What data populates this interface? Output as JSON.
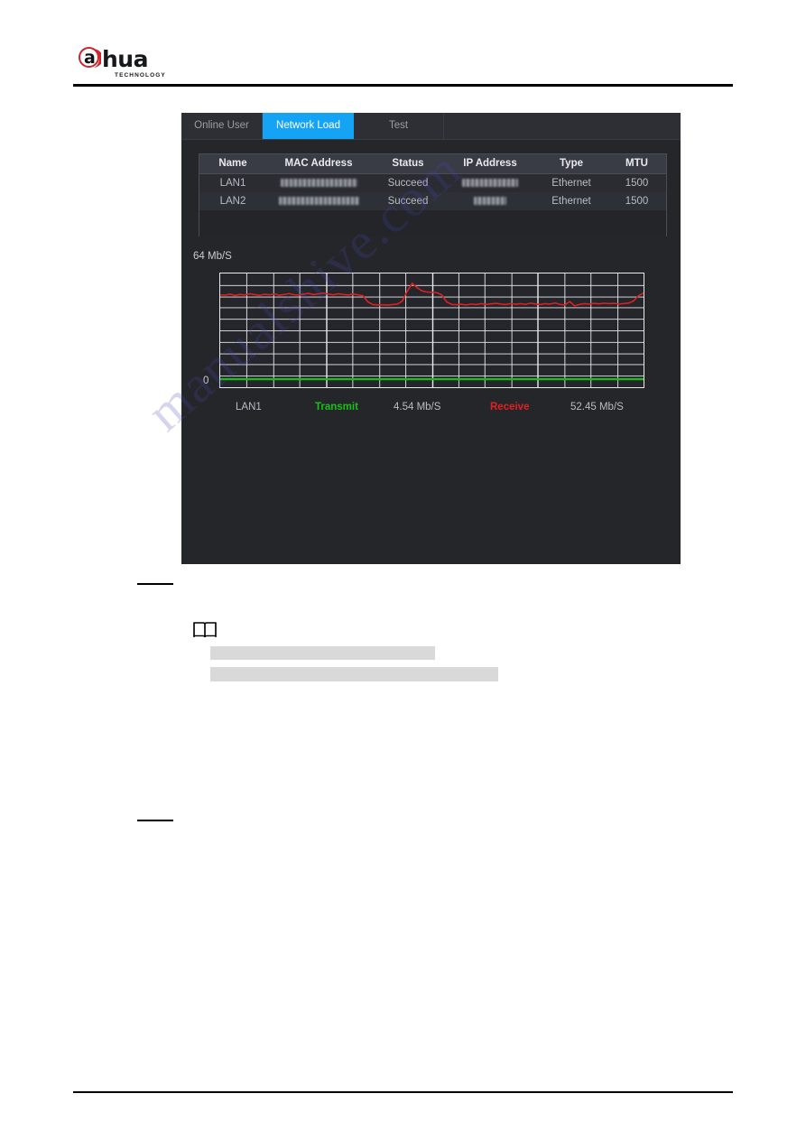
{
  "brand": {
    "name": "alhua",
    "letter": "a",
    "wordmark": "hua",
    "tagline": "TECHNOLOGY"
  },
  "device_ui": {
    "tabs": [
      {
        "label": "Online User",
        "active": false
      },
      {
        "label": "Network Load",
        "active": true
      },
      {
        "label": "Test",
        "active": false
      }
    ],
    "nic_table": {
      "headers": [
        "Name",
        "MAC Address",
        "Status",
        "IP Address",
        "Type",
        "MTU"
      ],
      "rows": [
        {
          "name": "LAN1",
          "mac": "",
          "status": "Succeed",
          "ip": "",
          "type": "Ethernet",
          "mtu": "1500"
        },
        {
          "name": "LAN2",
          "mac": "",
          "status": "Succeed",
          "ip": "",
          "type": "Ethernet",
          "mtu": "1500"
        }
      ]
    },
    "legend": {
      "interface": "LAN1",
      "transmit_label": "Transmit",
      "transmit_value": "4.54 Mb/S",
      "receive_label": "Receive",
      "receive_value": "52.45 Mb/S"
    },
    "colors": {
      "accent": "#15a4f5",
      "panel": "#252629",
      "transmit": "#18c018",
      "receive": "#e02020",
      "grid": "#e9eaec"
    }
  },
  "chart_data": {
    "type": "line",
    "title": "Network Load",
    "xlabel": "",
    "ylabel": "Mb/S",
    "ylim": [
      0,
      64
    ],
    "ytick_labels": [
      "64 Mb/S",
      "0"
    ],
    "grid": true,
    "legend_position": "bottom",
    "series": [
      {
        "name": "Receive",
        "color": "#e02020",
        "unit": "Mb/S",
        "current": 52.45,
        "values": [
          52.0,
          51.8,
          52.4,
          51.6,
          52.2,
          51.9,
          52.6,
          52.1,
          51.7,
          52.3,
          52.0,
          52.5,
          51.8,
          52.2,
          52.7,
          52.0,
          51.9,
          52.4,
          52.8,
          52.1,
          52.5,
          53.0,
          52.4,
          52.0,
          52.6,
          52.2,
          51.9,
          52.4,
          52.0,
          51.5,
          48.0,
          46.5,
          46.3,
          46.4,
          46.2,
          46.5,
          46.8,
          48.5,
          54.0,
          58.5,
          56.0,
          54.2,
          53.6,
          53.4,
          53.2,
          52.0,
          48.0,
          46.6,
          46.4,
          46.7,
          46.3,
          46.8,
          46.5,
          47.0,
          46.6,
          46.9,
          47.2,
          46.8,
          46.5,
          47.1,
          46.7,
          47.0,
          46.6,
          47.3,
          46.9,
          46.5,
          47.0,
          46.8,
          47.4,
          46.6,
          46.3,
          48.2,
          45.8,
          46.6,
          47.0,
          46.8,
          47.2,
          46.9,
          47.3,
          47.0,
          47.2,
          46.8,
          47.1,
          47.4,
          48.6,
          51.5,
          53.0
        ]
      },
      {
        "name": "Transmit",
        "color": "#18c018",
        "unit": "Mb/S",
        "current": 4.54,
        "values": [
          4.5,
          4.5,
          4.5,
          4.5,
          4.5,
          4.5,
          4.5,
          4.5,
          4.5,
          4.5,
          4.5,
          4.5,
          4.5,
          4.5,
          4.5,
          4.5,
          4.5,
          4.5,
          4.5,
          4.5,
          4.5,
          4.5,
          4.5,
          4.5,
          4.5,
          4.5,
          4.5,
          4.5,
          4.5,
          4.5,
          4.5,
          4.5,
          4.5,
          4.5,
          4.5,
          4.5,
          4.5,
          4.5,
          4.5,
          4.5,
          4.5,
          4.5,
          4.5,
          4.5,
          4.5,
          4.5,
          4.5,
          4.5,
          4.5,
          4.5,
          4.5,
          4.5,
          4.5,
          4.5,
          4.5,
          4.5,
          4.5,
          4.5,
          4.5,
          4.5,
          4.5,
          4.5,
          4.5,
          4.5,
          4.5,
          4.5,
          4.5,
          4.5,
          4.5,
          4.5,
          4.5,
          4.5,
          4.5,
          4.5,
          4.5,
          4.5,
          4.5,
          4.5,
          4.5,
          4.5,
          4.5,
          4.5,
          4.5,
          4.5,
          4.5,
          4.5,
          4.5
        ]
      }
    ],
    "grid_cols": 16,
    "grid_rows": 10
  }
}
